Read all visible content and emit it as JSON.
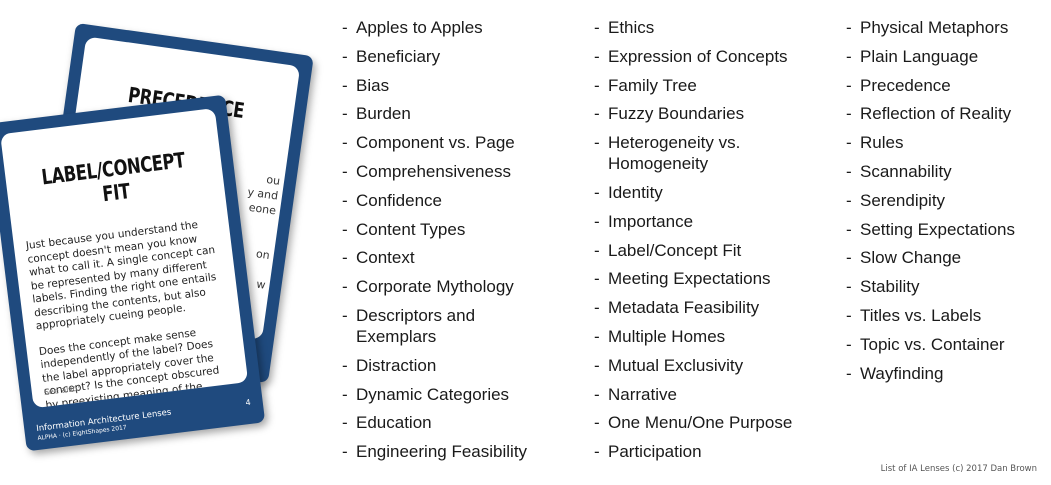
{
  "cards": {
    "back": {
      "title": "PRECEDENCE",
      "fragments": [
        "ou",
        "y and",
        "eone",
        "on",
        "w"
      ]
    },
    "front": {
      "title": "LABEL/CONCEPT FIT",
      "description": "Just because you understand the concept doesn't mean you know what to call it. A single concept can be represented by many different labels. Finding the right one entails describing the contents, but also appropriately cueing people.",
      "questions": "Does the concept make sense independently of the label? Does the label appropriately cover the concept? Is the concept obscured by preexisting meaning of the label?",
      "see_also": "See also:",
      "footer_title": "Information Architecture Lenses",
      "footer_copyright": "ALPHA · (c) EightShapes 2017",
      "number": "4"
    }
  },
  "lenses": {
    "column1": [
      "Apples to Apples",
      "Beneficiary",
      "Bias",
      "Burden",
      "Component vs. Page",
      "Comprehensiveness",
      "Confidence",
      "Content Types",
      "Context",
      "Corporate Mythology",
      "Descriptors and\nExemplars",
      "Distraction",
      "Dynamic Categories",
      "Education",
      "Engineering Feasibility"
    ],
    "column2": [
      "Ethics",
      "Expression of Concepts",
      "Family Tree",
      "Fuzzy Boundaries",
      "Heterogeneity vs.\nHomogeneity",
      "Identity",
      "Importance",
      "Label/Concept Fit",
      "Meeting Expectations",
      "Metadata Feasibility",
      "Multiple Homes",
      "Mutual Exclusivity",
      "Narrative",
      "One Menu/One Purpose",
      "Participation"
    ],
    "column3": [
      "Physical Metaphors",
      "Plain Language",
      "Precedence",
      "Reflection of Reality",
      "Rules",
      "Scannability",
      "Serendipity",
      "Setting Expectations",
      "Slow Change",
      "Stability",
      "Titles vs. Labels",
      "Topic vs. Container",
      "Wayfinding"
    ]
  },
  "credit": "List of IA Lenses (c) 2017 Dan Brown"
}
